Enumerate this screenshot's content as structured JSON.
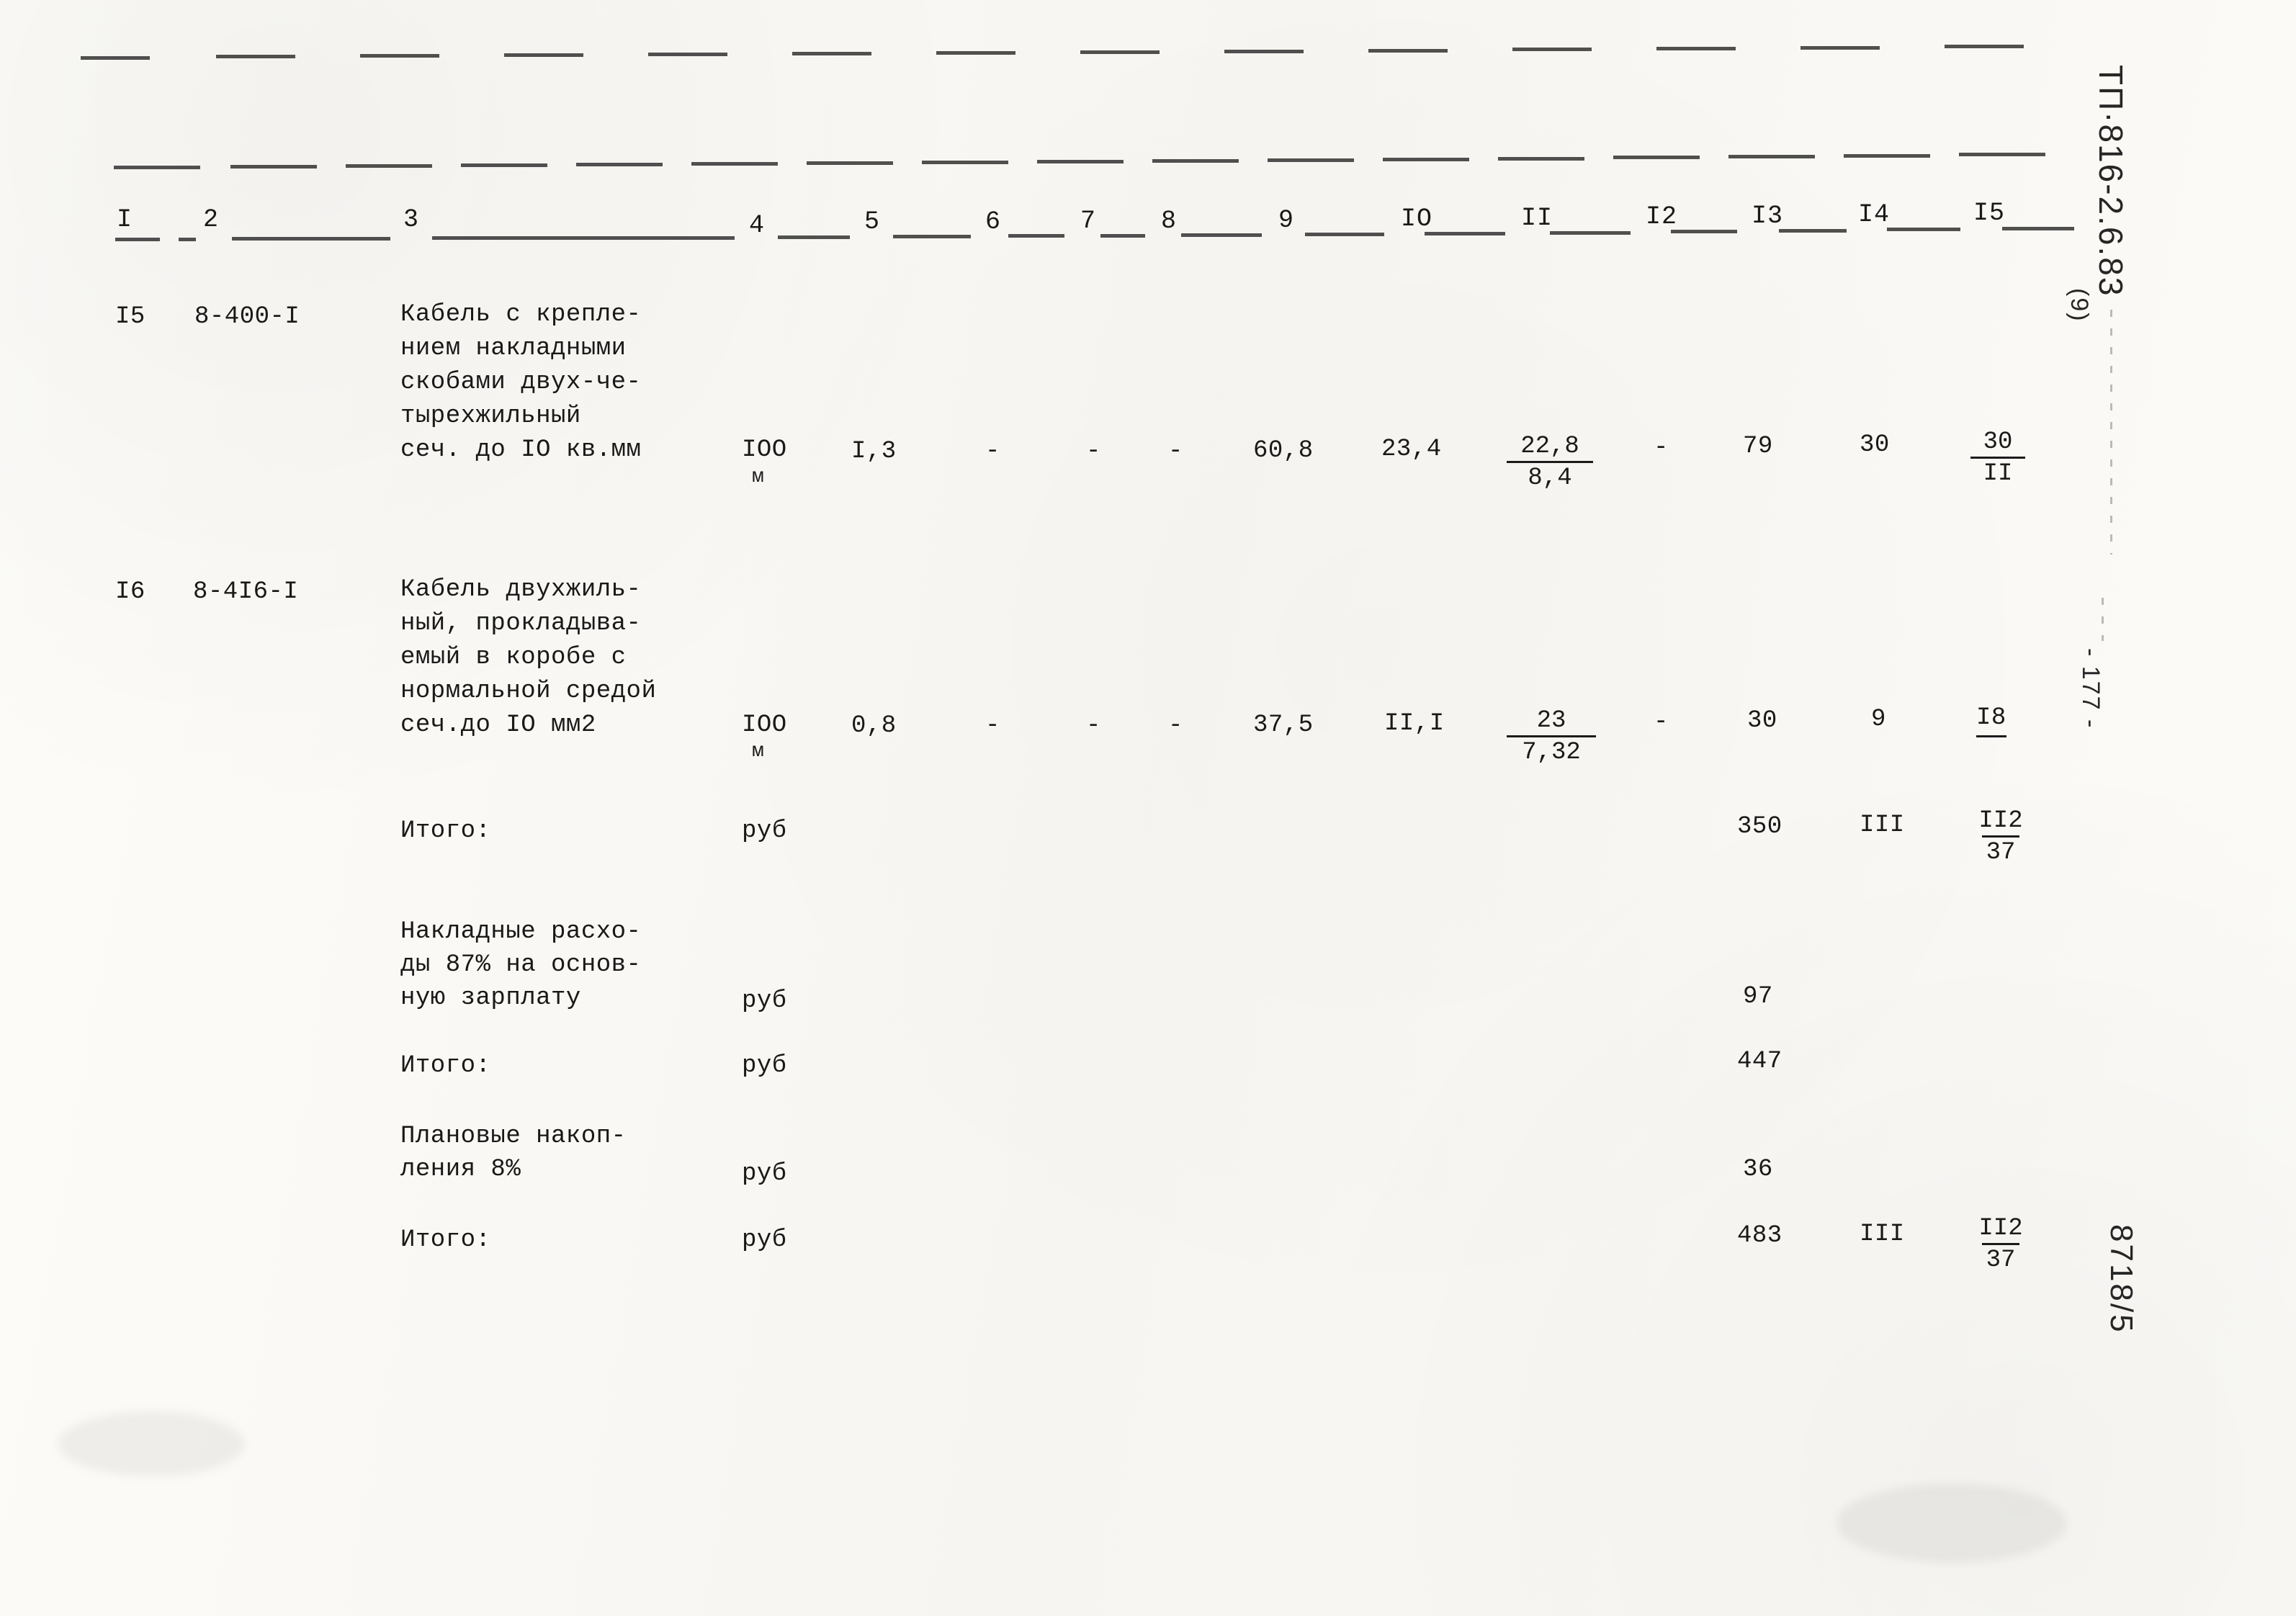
{
  "document": {
    "type": "scanned-estimate-table",
    "language": "ru",
    "column_headers": [
      "I",
      "2",
      "3",
      "4",
      "5",
      "6",
      "7",
      "8",
      "9",
      "IO",
      "II",
      "I2",
      "I3",
      "I4",
      "I5"
    ],
    "margin_stamps": {
      "top_right": "ТП·816-2.6.83",
      "top_right_sub": "(9)",
      "right_page": "- 177 -",
      "bottom_right": "8718/5"
    },
    "rows": [
      {
        "no": "I5",
        "code": "8-400-I",
        "description_lines": [
          "Кабель с крепле-",
          "нием накладными",
          "скобами двух-че-",
          "тырехжильный",
          "сеч. до IО кв.мм"
        ],
        "unit": "IОО",
        "unit_sub": "м",
        "c5": "I,3",
        "c6": "-",
        "c7": "-",
        "c8": "-",
        "c9": "60,8",
        "c10": "23,4",
        "c11_num": "22,8",
        "c11_den": "8,4",
        "c12": "-",
        "c13": "79",
        "c14": "30",
        "c15_num": "30",
        "c15_den": "II"
      },
      {
        "no": "I6",
        "code": "8-4I6-I",
        "description_lines": [
          "Кабель двухжиль-",
          "ный, прокладыва-",
          "емый в коробе с",
          "нормальной средой",
          "сеч.до IО мм2"
        ],
        "unit": "IОО",
        "unit_sub": "м",
        "c5": "0,8",
        "c6": "-",
        "c7": "-",
        "c8": "-",
        "c9": "37,5",
        "c10": "II,I",
        "c11_num": "23",
        "c11_den": "7,32",
        "c12": "-",
        "c13": "30",
        "c14": "9",
        "c15_num": "I8",
        "c15_den": ""
      }
    ],
    "totals": [
      {
        "label_lines": [
          "Итого:"
        ],
        "unit": "руб",
        "c13": "350",
        "c14": "III",
        "c15_num": "II2",
        "c15_den": "37"
      },
      {
        "label_lines": [
          "Накладные расхо-",
          "ды 87% на основ-",
          "ную зарплату"
        ],
        "unit": "руб",
        "c13": "97",
        "c14": "",
        "c15_num": "",
        "c15_den": ""
      },
      {
        "label_lines": [
          "Итого:"
        ],
        "unit": "руб",
        "c13": "447",
        "c14": "",
        "c15_num": "",
        "c15_den": ""
      },
      {
        "label_lines": [
          "Плановые накоп-",
          "ления 8%"
        ],
        "unit": "руб",
        "c13": "36",
        "c14": "",
        "c15_num": "",
        "c15_den": ""
      },
      {
        "label_lines": [
          "Итого:"
        ],
        "unit": "руб",
        "c13": "483",
        "c14": "III",
        "c15_num": "II2",
        "c15_den": "37"
      }
    ]
  }
}
